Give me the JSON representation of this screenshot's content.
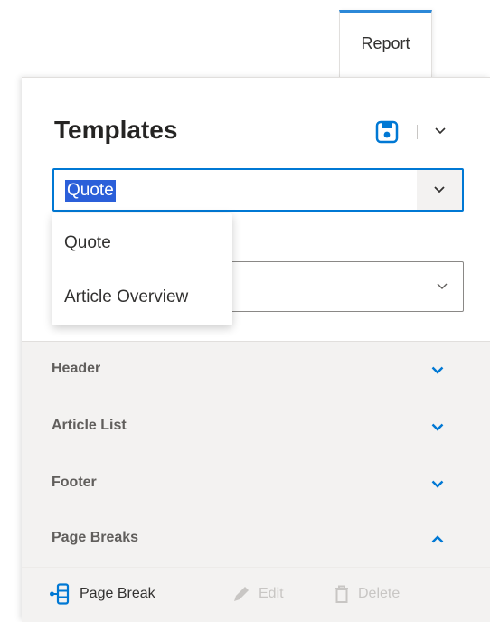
{
  "tab": {
    "label": "Report"
  },
  "panel": {
    "title": "Templates"
  },
  "template_select": {
    "value": "Quote"
  },
  "second_select": {
    "value": ""
  },
  "dropdown": {
    "options": [
      "Quote",
      "Article Overview"
    ]
  },
  "sections": [
    {
      "label": "Header",
      "state": "collapsed"
    },
    {
      "label": "Article List",
      "state": "collapsed"
    },
    {
      "label": "Footer",
      "state": "collapsed"
    },
    {
      "label": "Page Breaks",
      "state": "expanded"
    }
  ],
  "toolbar": {
    "page_break_label": "Page Break",
    "edit_label": "Edit",
    "delete_label": "Delete"
  },
  "colors": {
    "accent": "#0078d4",
    "selection": "#2b5fd9",
    "section_bg": "#f3f2f1"
  },
  "icons": [
    "save-icon",
    "chevron-down-icon",
    "chevron-up-icon",
    "page-break-icon",
    "pencil-icon",
    "trash-icon"
  ]
}
